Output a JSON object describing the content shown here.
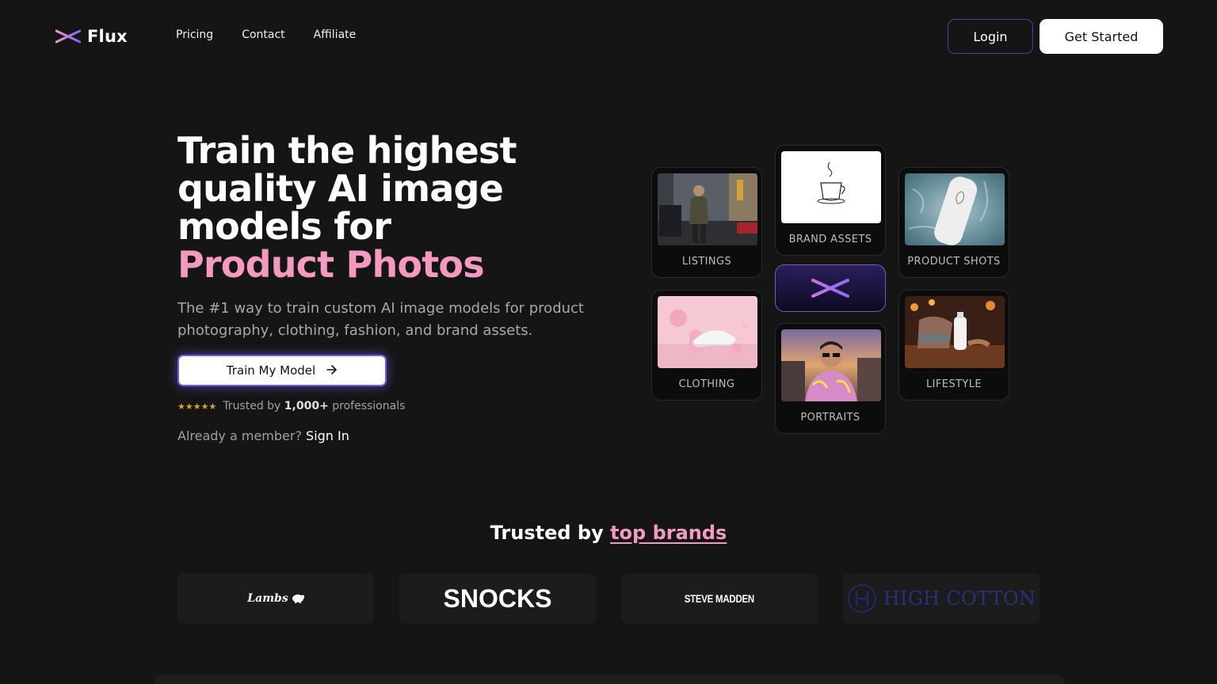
{
  "nav": {
    "logo_text": "Flux",
    "links": [
      "Pricing",
      "Contact",
      "Affiliate"
    ],
    "login_label": "Login",
    "get_started_label": "Get Started"
  },
  "hero": {
    "title_line1": "Train the highest",
    "title_line2": "quality AI image",
    "title_line3": "models for",
    "title_highlight": "Product Photos",
    "subtitle": "The #1 way to train custom AI image models for product photography, clothing, fashion, and brand assets.",
    "cta_label": "Train My Model",
    "cta_icon": "arrow-right-icon",
    "stars": "★★★★★",
    "trusted_prefix": "Trusted by",
    "trusted_count": "1,000+",
    "trusted_suffix": "professionals",
    "member_prompt": "Already a member?",
    "sign_in_label": "Sign In"
  },
  "tiles": [
    {
      "label": "LISTINGS"
    },
    {
      "label": "BRAND ASSETS"
    },
    {
      "label": "PRODUCT SHOTS"
    },
    {
      "label": "CLOTHING"
    },
    {
      "label": "PORTRAITS"
    },
    {
      "label": "LIFESTYLE"
    }
  ],
  "brands": {
    "title_prefix": "Trusted by",
    "title_highlight": "top brands",
    "logos": [
      "Lambs",
      "SNOCKS",
      "STEVE MADDEN",
      "HIGH COTTON"
    ]
  },
  "colors": {
    "background": "#151515",
    "accent_pink": "#f49ac1",
    "accent_purple": "#6d5ce0",
    "logo_gradient_start": "#f49ac1",
    "logo_gradient_end": "#7c63ff"
  }
}
